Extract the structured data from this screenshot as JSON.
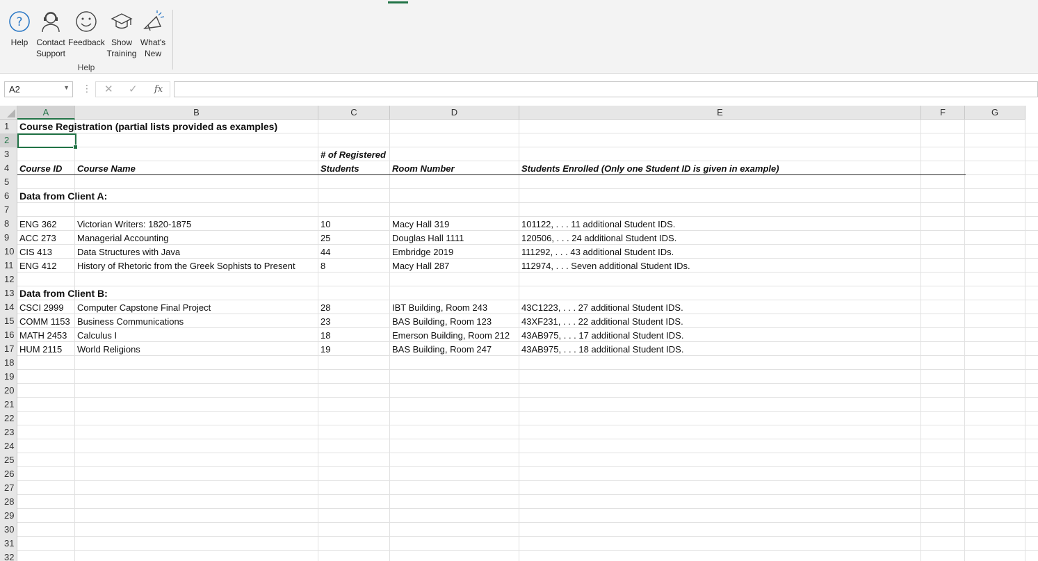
{
  "ribbon": {
    "buttons": [
      {
        "label": "Help",
        "icon": "help-circle-icon"
      },
      {
        "label": "Contact\nSupport",
        "icon": "headset-person-icon"
      },
      {
        "label": "Feedback",
        "icon": "smiley-icon"
      },
      {
        "label": "Show\nTraining",
        "icon": "graduation-cap-icon"
      },
      {
        "label": "What's\nNew",
        "icon": "megaphone-icon"
      }
    ],
    "group_label": "Help",
    "accent_color": "#217346"
  },
  "formula_bar": {
    "name_box": "A2",
    "fx_label": "fx",
    "formula": ""
  },
  "grid": {
    "columns": [
      "A",
      "B",
      "C",
      "D",
      "E",
      "F",
      "G"
    ],
    "selected_column": "A",
    "selected_row": "2",
    "rows": [
      {
        "num": "1",
        "A": "Course Registration (partial lists provided as examples)",
        "B": "",
        "C": "",
        "D": "",
        "E": ""
      },
      {
        "num": "2",
        "A": "",
        "B": "",
        "C": "",
        "D": "",
        "E": ""
      },
      {
        "num": "3",
        "A": "",
        "B": "",
        "C": "# of Registered",
        "D": "",
        "E": ""
      },
      {
        "num": "4",
        "A": "Course ID",
        "B": "Course Name",
        "C": "Students",
        "D": "Room Number",
        "E": "Students Enrolled (Only one Student ID is given in example)"
      },
      {
        "num": "5",
        "A": "",
        "B": "",
        "C": "",
        "D": "",
        "E": ""
      },
      {
        "num": "6",
        "A": "Data from Client A:",
        "B": "",
        "C": "",
        "D": "",
        "E": ""
      },
      {
        "num": "7",
        "A": "",
        "B": "",
        "C": "",
        "D": "",
        "E": ""
      },
      {
        "num": "8",
        "A": "ENG 362",
        "B": "Victorian Writers: 1820-1875",
        "C": "10",
        "D": "Macy Hall 319",
        "E": "101122, . . . 11 additional Student IDS."
      },
      {
        "num": "9",
        "A": "ACC 273",
        "B": "Managerial Accounting",
        "C": "25",
        "D": "Douglas Hall 1111",
        "E": "120506, . . . 24 additional Student IDS."
      },
      {
        "num": "10",
        "A": "CIS 413",
        "B": "Data Structures with Java",
        "C": "44",
        "D": "Embridge 2019",
        "E": "111292, . . . 43 additional Student IDs."
      },
      {
        "num": "11",
        "A": "ENG 412",
        "B": "History of Rhetoric from the Greek Sophists to Present",
        "C": "8",
        "D": "Macy Hall 287",
        "E": "112974, . . . Seven additional Student IDs."
      },
      {
        "num": "12",
        "A": "",
        "B": "",
        "C": "",
        "D": "",
        "E": ""
      },
      {
        "num": "13",
        "A": "Data from Client B:",
        "B": "",
        "C": "",
        "D": "",
        "E": ""
      },
      {
        "num": "14",
        "A": "CSCI 2999",
        "B": "Computer Capstone Final Project",
        "C": "28",
        "D": "IBT Building, Room 243",
        "E": "43C1223, . . . 27 additional Student IDS."
      },
      {
        "num": "15",
        "A": "COMM 1153",
        "B": "Business Communications",
        "C": "23",
        "D": "BAS Building, Room 123",
        "E": "43XF231, . . . 22 additional Student IDS."
      },
      {
        "num": "16",
        "A": "MATH 2453",
        "B": "Calculus I",
        "C": "18",
        "D": "Emerson Building, Room 212",
        "E": "43AB975, . . . 17 additional Student IDS."
      },
      {
        "num": "17",
        "A": "HUM 2115",
        "B": "World Religions",
        "C": "19",
        "D": "BAS Building, Room 247",
        "E": "43AB975, . . . 18 additional Student IDS."
      },
      {
        "num": "18"
      },
      {
        "num": "19"
      },
      {
        "num": "20"
      },
      {
        "num": "21"
      },
      {
        "num": "22"
      },
      {
        "num": "23"
      },
      {
        "num": "24"
      },
      {
        "num": "25"
      },
      {
        "num": "26"
      },
      {
        "num": "27"
      },
      {
        "num": "28"
      },
      {
        "num": "29"
      },
      {
        "num": "30"
      },
      {
        "num": "31"
      },
      {
        "num": "32"
      }
    ]
  }
}
